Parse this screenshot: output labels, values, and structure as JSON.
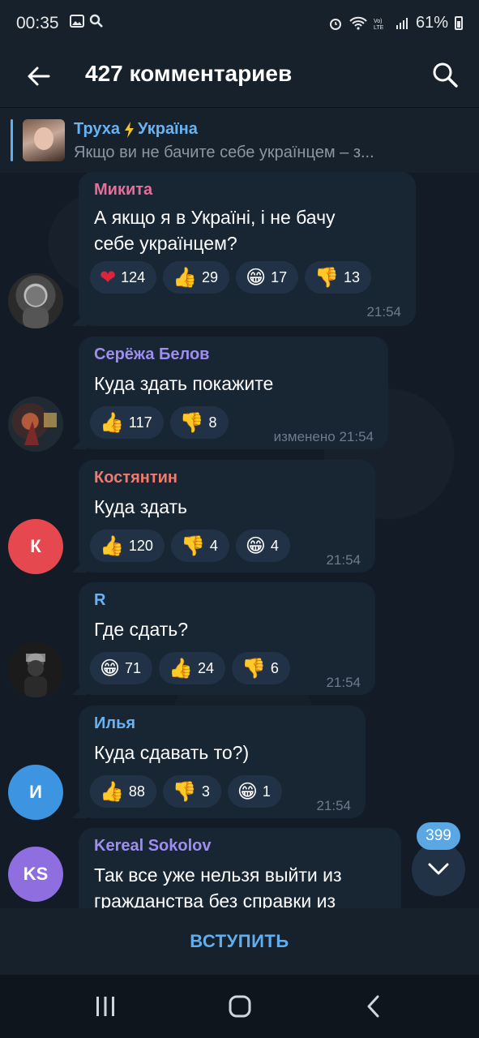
{
  "status_bar": {
    "time": "00:35",
    "battery": "61%",
    "icons": [
      "gallery-icon",
      "search-icon",
      "alarm-icon",
      "wifi-icon",
      "volte-icon",
      "signal-icon",
      "battery-icon"
    ]
  },
  "header": {
    "title": "427 комментариев",
    "back_icon": "arrow-left-icon",
    "search_icon": "search-icon"
  },
  "pinned": {
    "channel": "Труха",
    "channel_suffix": "Україна",
    "text": "Якщо ви не бачите себе українцем – з..."
  },
  "messages": [
    {
      "author": "Микита",
      "author_color": "#e56f9a",
      "lines": [
        "А якщо я в Україні, і не бачу",
        "себе українцем?"
      ],
      "reactions": [
        {
          "emoji": "❤",
          "count": "124"
        },
        {
          "emoji": "👍",
          "count": "29"
        },
        {
          "emoji": "😁",
          "count": "17"
        },
        {
          "emoji": "👎",
          "count": "13"
        }
      ],
      "time": "21:54"
    },
    {
      "author": "Серёжа Белов",
      "author_color": "#9d8ef0",
      "lines": [
        "Куда здать покажите"
      ],
      "reactions": [
        {
          "emoji": "👍",
          "count": "117"
        },
        {
          "emoji": "👎",
          "count": "8"
        }
      ],
      "time": "изменено 21:54"
    },
    {
      "author": "Костянтин",
      "author_color": "#f07a6c",
      "avatar_letter": "К",
      "lines": [
        "Куда здать"
      ],
      "reactions": [
        {
          "emoji": "👍",
          "count": "120"
        },
        {
          "emoji": "👎",
          "count": "4"
        },
        {
          "emoji": "😁",
          "count": "4"
        }
      ],
      "time": "21:54"
    },
    {
      "author": "R",
      "author_color": "#6ab3f3",
      "lines": [
        "Где сдать?"
      ],
      "reactions": [
        {
          "emoji": "😁",
          "count": "71"
        },
        {
          "emoji": "👍",
          "count": "24"
        },
        {
          "emoji": "👎",
          "count": "6"
        }
      ],
      "time": "21:54"
    },
    {
      "author": "Илья",
      "author_color": "#6ab3f3",
      "avatar_letter": "И",
      "lines": [
        "Куда сдавать то?)"
      ],
      "reactions": [
        {
          "emoji": "👍",
          "count": "88"
        },
        {
          "emoji": "👎",
          "count": "3"
        },
        {
          "emoji": "😁",
          "count": "1"
        }
      ],
      "time": "21:54"
    },
    {
      "author": "Kereal Sokolov",
      "author_color": "#9d8ef0",
      "avatar_letter": "KS",
      "lines": [
        "Так все уже нельзя выйти из",
        "гражданства без справки из"
      ]
    }
  ],
  "scroll_down": {
    "unread_count": "399"
  },
  "join_button": "ВСТУПИТЬ",
  "colors": {
    "accent": "#5eaef0",
    "bubble": "#182533",
    "background": "#0e1621"
  }
}
